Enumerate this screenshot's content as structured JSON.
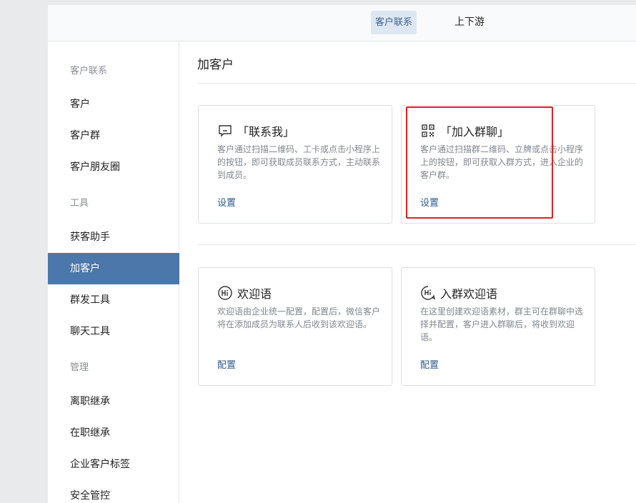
{
  "topbar": {
    "tabs": [
      {
        "label": "客户联系",
        "active": true
      },
      {
        "label": "上下游",
        "active": false
      }
    ]
  },
  "sidebar": {
    "groups": [
      {
        "title": "客户联系",
        "items": [
          "客户",
          "客户群",
          "客户朋友圈"
        ]
      },
      {
        "title": "工具",
        "items": [
          "获客助手",
          "加客户",
          "群发工具",
          "聊天工具"
        ]
      },
      {
        "title": "管理",
        "items": [
          "离职继承",
          "在职继承",
          "企业客户标签",
          "安全管控"
        ]
      }
    ],
    "active_item": "加客户"
  },
  "main": {
    "title": "加客户",
    "cards": [
      {
        "icon": "chat-bubble-icon",
        "title": "「联系我」",
        "desc": "客户通过扫描二维码、工卡或点击小程序上的按钮，即可获取成员联系方式，主动联系到成员。",
        "link": "设置"
      },
      {
        "icon": "qr-code-icon",
        "title": "「加入群聊」",
        "desc": "客户通过扫描群二维码、立牌或点击小程序上的按钮，即可获取入群方式，进入企业的客户群。",
        "link": "设置"
      },
      {
        "icon": "hi-greeting-icon",
        "title": "欢迎语",
        "desc": "欢迎语由企业统一配置，配置后，微信客户将在添加成员为联系人后收到该欢迎语。",
        "link": "配置"
      },
      {
        "icon": "group-hi-greeting-icon",
        "title": "入群欢迎语",
        "desc": "在这里创建欢迎语素材，群主可在群聊中选择并配置，客户进入群聊后，将收到欢迎语。",
        "link": "配置"
      }
    ]
  },
  "colors": {
    "accent": "#4b77aa",
    "active_tab_bg": "#dde7f2",
    "link": "#2d5b8f",
    "highlight_box": "#e02020"
  }
}
